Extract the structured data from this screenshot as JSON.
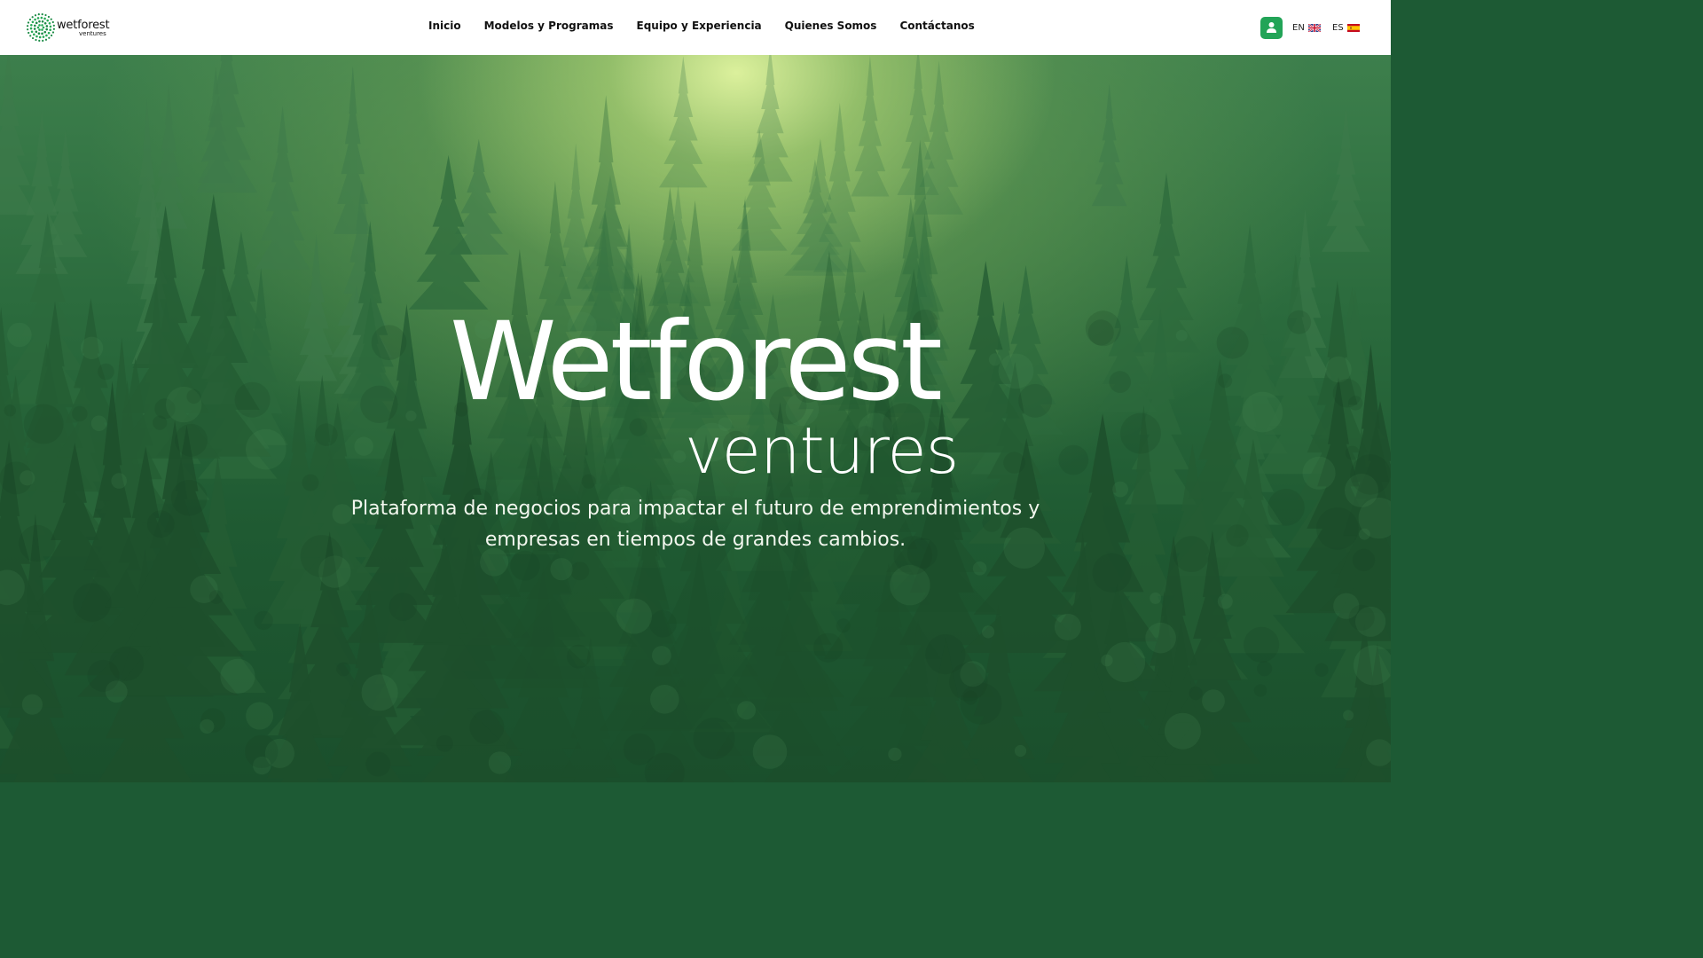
{
  "header": {
    "logo": {
      "word": "wetforest",
      "sub": "ventures"
    },
    "nav": [
      {
        "label": "Inicio"
      },
      {
        "label": "Modelos y Programas"
      },
      {
        "label": "Equipo y Experiencia"
      },
      {
        "label": "Quienes Somos"
      },
      {
        "label": "Contáctanos"
      }
    ],
    "user_icon": "user-icon",
    "languages": [
      {
        "code": "EN",
        "flag": "uk-flag-icon"
      },
      {
        "code": "ES",
        "flag": "spain-flag-icon"
      }
    ]
  },
  "hero": {
    "title": "Wetforest",
    "subtitle": "ventures",
    "tagline": "Plataforma de negocios para impactar el futuro de emprendimientos y empresas en tiempos de grandes cambios."
  },
  "colors": {
    "accent": "#22a457",
    "hero_green": "#1f5a32",
    "mist": "#e2f5a0"
  }
}
